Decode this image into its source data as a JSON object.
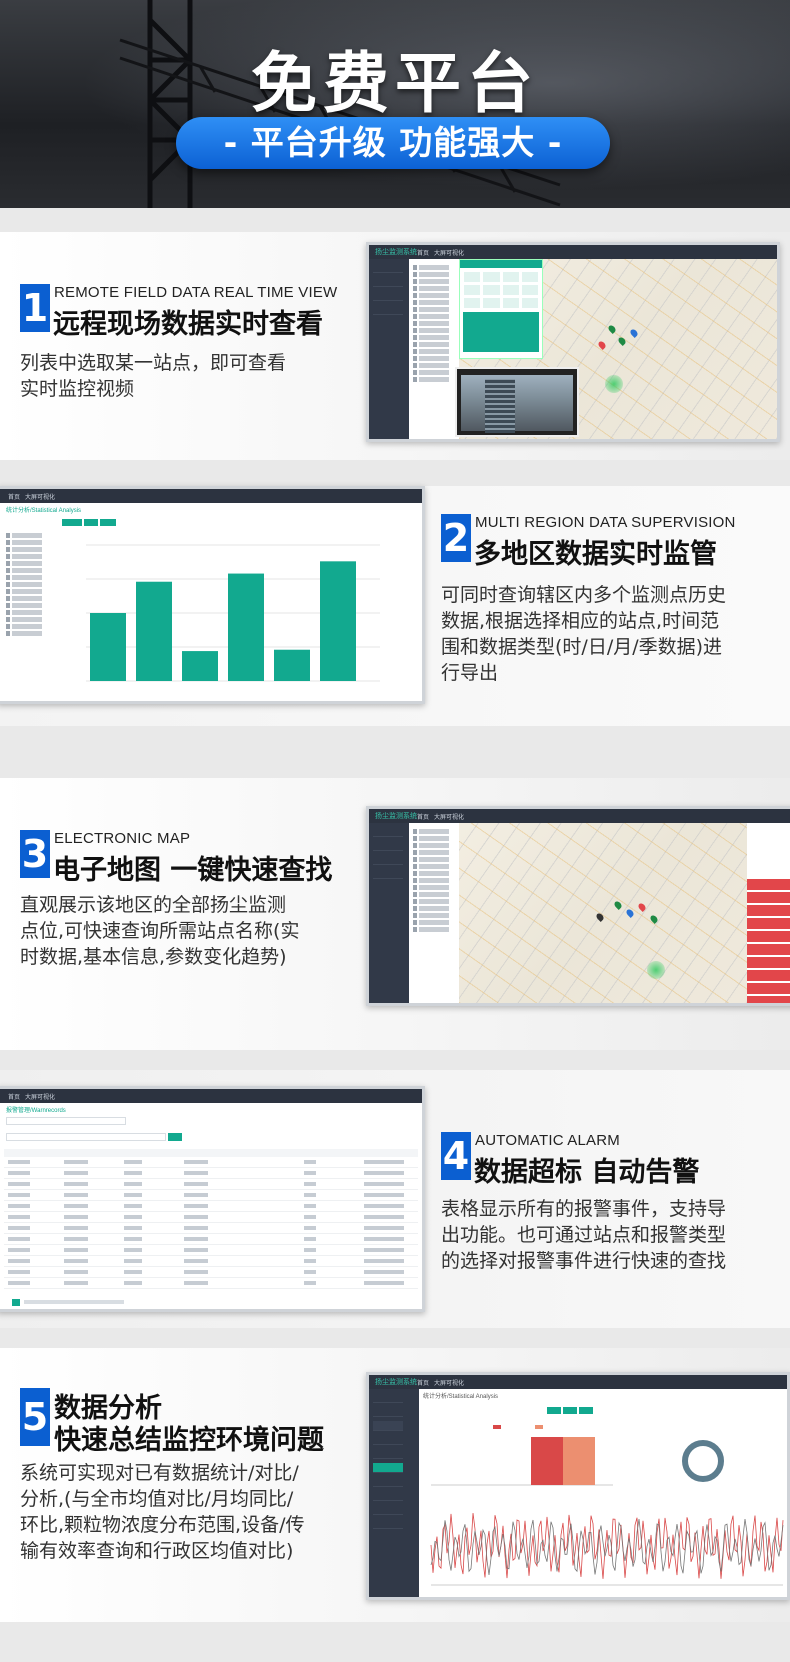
{
  "banner": {
    "title": "免费平台",
    "subtitle": "- 平台升级 功能强大 -"
  },
  "features": [
    {
      "number": "1",
      "en": "REMOTE FIELD DATA REAL TIME VIEW",
      "title": "远程现场数据实时查看",
      "desc": [
        "列表中选取某一站点，即可查看",
        "实时监控视频"
      ]
    },
    {
      "number": "2",
      "en": "MULTI REGION DATA SUPERVISION",
      "title": "多地区数据实时监管",
      "desc": [
        "可同时查询辖区内多个监测点历史",
        "数据,根据选择相应的站点,时间范",
        "围和数据类型(时/日/月/季数据)进",
        "行导出"
      ]
    },
    {
      "number": "3",
      "en": "ELECTRONIC MAP",
      "title": "电子地图 一键快速查找",
      "desc": [
        "直观展示该地区的全部扬尘监测",
        "点位,可快速查询所需站点名称(实",
        "时数据,基本信息,参数变化趋势)"
      ]
    },
    {
      "number": "4",
      "en": "AUTOMATIC ALARM",
      "title": "数据超标 自动告警",
      "desc": [
        "表格显示所有的报警事件，支持导",
        "出功能。也可通过站点和报警类型",
        "的选择对报警事件进行快速的查找"
      ]
    },
    {
      "number": "5",
      "title": "数据分析",
      "title2": "快速总结监控环境问题",
      "desc": [
        "系统可实现对已有数据统计/对比/",
        "分析,(与全市均值对比/月均同比/",
        "环比,颗粒物浓度分布范围,设备/传",
        "输有效率查询和行政区均值对比)"
      ]
    }
  ],
  "screens": {
    "s2_title": "统计分析/Statistical Analysis",
    "s2_bars": [
      0.5,
      0.73,
      0.22,
      0.79,
      0.23,
      0.88
    ],
    "s4_title": "报警管理/Warnrecords",
    "s5_title": "统计分析/Statistical Analysis",
    "colors": {
      "teal": "#12a98f",
      "blue": "#0b5fd1",
      "red": "#e2464a"
    }
  }
}
